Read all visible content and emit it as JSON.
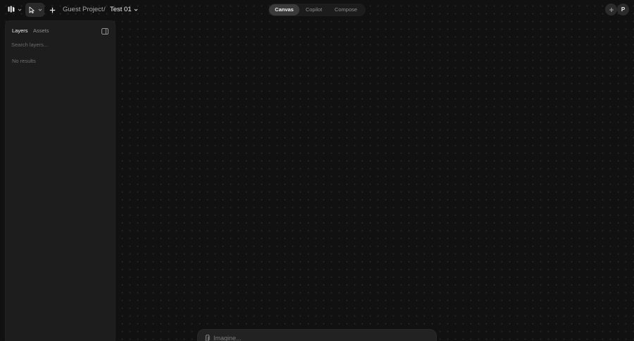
{
  "header": {
    "logo_icon": "logo-icon",
    "tool_icon": "cursor-arrow-icon",
    "add_icon": "plus-icon",
    "breadcrumb": {
      "project": "Guest Project",
      "separator": "/",
      "page": "Test 01"
    },
    "modes": [
      {
        "label": "Canvas",
        "active": true
      },
      {
        "label": "Copilot",
        "active": false
      },
      {
        "label": "Compose",
        "active": false
      }
    ],
    "avatar_initial": "P"
  },
  "sidebar": {
    "tabs": [
      {
        "label": "Layers",
        "active": true
      },
      {
        "label": "Assets",
        "active": false
      }
    ],
    "search_placeholder": "Search layers...",
    "empty_text": "No results"
  },
  "prompt": {
    "placeholder": "Imagine..."
  },
  "colors": {
    "background": "#111111",
    "panel": "#1d1d1d",
    "active_tab": "#3a3a3a"
  }
}
